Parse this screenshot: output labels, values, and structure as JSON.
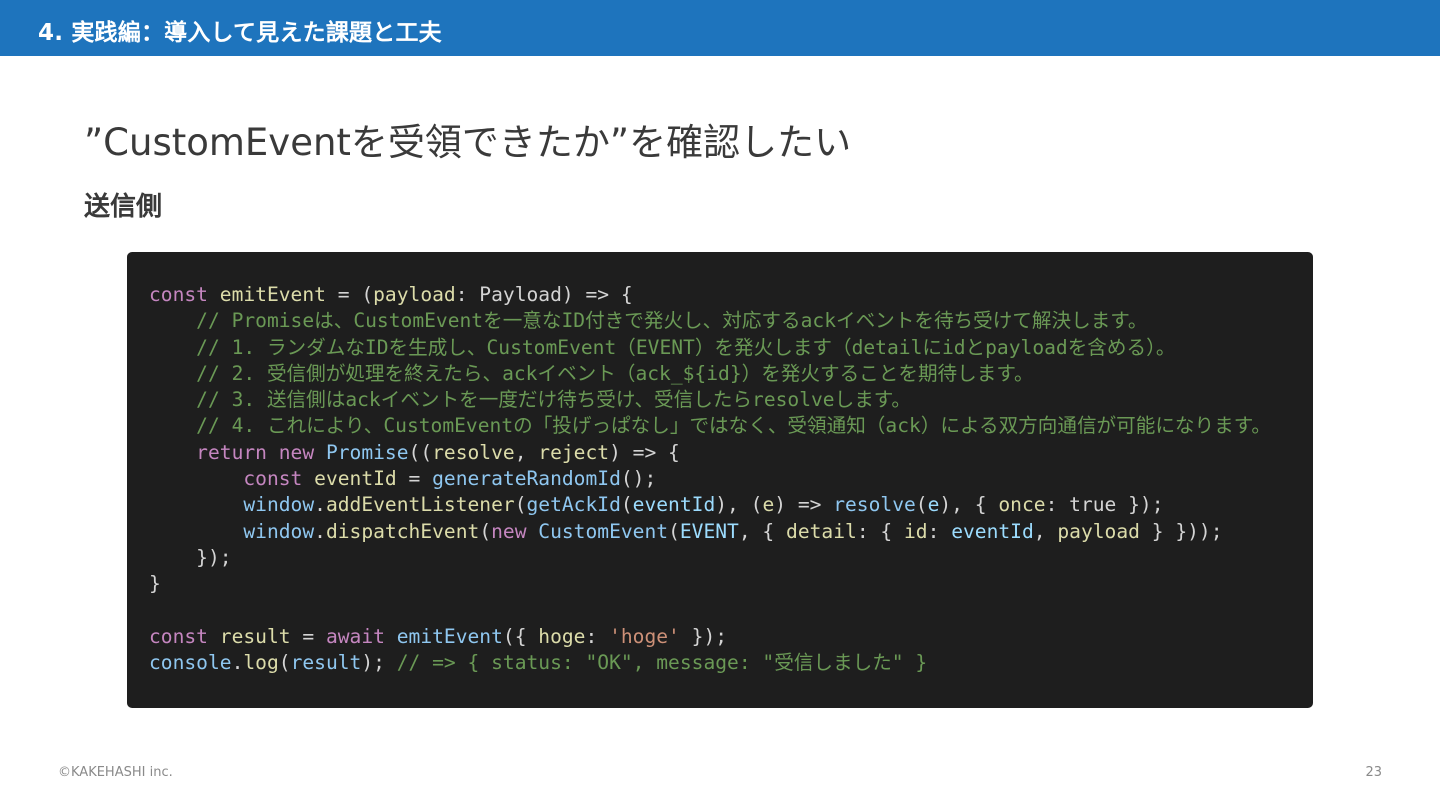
{
  "header": {
    "title": "4. 実践編：導入して見えた課題と工夫"
  },
  "slide": {
    "title": "”CustomEventを受領できたか”を確認したい",
    "section_label": "送信側"
  },
  "code": {
    "lines": [
      [
        {
          "t": "const ",
          "c": "kw"
        },
        {
          "t": "emitEvent",
          "c": "var"
        },
        {
          "t": " = (",
          "c": "pl"
        },
        {
          "t": "payload",
          "c": "var"
        },
        {
          "t": ": Payload) => {",
          "c": "pl"
        }
      ],
      [
        {
          "t": "    // Promiseは、CustomEventを一意なID付きで発火し、対応するackイベントを待ち受けて解決します。",
          "c": "cm"
        }
      ],
      [
        {
          "t": "    // 1. ランダムなIDを生成し、CustomEvent（EVENT）を発火します（detailにidとpayloadを含める）。",
          "c": "cm"
        }
      ],
      [
        {
          "t": "    // 2. 受信側が処理を終えたら、ackイベント（ack_${id}）を発火することを期待します。",
          "c": "cm"
        }
      ],
      [
        {
          "t": "    // 3. 送信側はackイベントを一度だけ待ち受け、受信したらresolveします。",
          "c": "cm"
        }
      ],
      [
        {
          "t": "    // 4. これにより、CustomEventの「投げっぱなし」ではなく、受領通知（ack）による双方向通信が可能になります。",
          "c": "cm"
        }
      ],
      [
        {
          "t": "    return ",
          "c": "kw"
        },
        {
          "t": "new ",
          "c": "kw"
        },
        {
          "t": "Promise",
          "c": "cls"
        },
        {
          "t": "((",
          "c": "pl"
        },
        {
          "t": "resolve",
          "c": "var"
        },
        {
          "t": ", ",
          "c": "pl"
        },
        {
          "t": "reject",
          "c": "var"
        },
        {
          "t": ") => {",
          "c": "pl"
        }
      ],
      [
        {
          "t": "        const ",
          "c": "kw"
        },
        {
          "t": "eventId",
          "c": "var"
        },
        {
          "t": " = ",
          "c": "pl"
        },
        {
          "t": "generateRandomId",
          "c": "fn"
        },
        {
          "t": "();",
          "c": "pl"
        }
      ],
      [
        {
          "t": "        window",
          "c": "fn"
        },
        {
          "t": ".",
          "c": "pl"
        },
        {
          "t": "addEventListener",
          "c": "var"
        },
        {
          "t": "(",
          "c": "pl"
        },
        {
          "t": "getAckId",
          "c": "fn"
        },
        {
          "t": "(",
          "c": "pl"
        },
        {
          "t": "eventId",
          "c": "const"
        },
        {
          "t": "), (",
          "c": "pl"
        },
        {
          "t": "e",
          "c": "var"
        },
        {
          "t": ") => ",
          "c": "pl"
        },
        {
          "t": "resolve",
          "c": "fn"
        },
        {
          "t": "(",
          "c": "pl"
        },
        {
          "t": "e",
          "c": "const"
        },
        {
          "t": "), { ",
          "c": "pl"
        },
        {
          "t": "once",
          "c": "prop"
        },
        {
          "t": ": true });",
          "c": "pl"
        }
      ],
      [
        {
          "t": "        window",
          "c": "fn"
        },
        {
          "t": ".",
          "c": "pl"
        },
        {
          "t": "dispatchEvent",
          "c": "var"
        },
        {
          "t": "(",
          "c": "pl"
        },
        {
          "t": "new ",
          "c": "kw"
        },
        {
          "t": "CustomEvent",
          "c": "cls"
        },
        {
          "t": "(",
          "c": "pl"
        },
        {
          "t": "EVENT",
          "c": "const"
        },
        {
          "t": ", { ",
          "c": "pl"
        },
        {
          "t": "detail",
          "c": "prop"
        },
        {
          "t": ": { ",
          "c": "pl"
        },
        {
          "t": "id",
          "c": "prop"
        },
        {
          "t": ": ",
          "c": "pl"
        },
        {
          "t": "eventId",
          "c": "const"
        },
        {
          "t": ", ",
          "c": "pl"
        },
        {
          "t": "payload",
          "c": "prop"
        },
        {
          "t": " } }));",
          "c": "pl"
        }
      ],
      [
        {
          "t": "    });",
          "c": "pl"
        }
      ],
      [
        {
          "t": "}",
          "c": "pl"
        }
      ],
      [
        {
          "t": "",
          "c": "pl"
        }
      ],
      [
        {
          "t": "const ",
          "c": "kw"
        },
        {
          "t": "result",
          "c": "var"
        },
        {
          "t": " = ",
          "c": "pl"
        },
        {
          "t": "await ",
          "c": "kw"
        },
        {
          "t": "emitEvent",
          "c": "fn"
        },
        {
          "t": "({ ",
          "c": "pl"
        },
        {
          "t": "hoge",
          "c": "prop"
        },
        {
          "t": ": ",
          "c": "pl"
        },
        {
          "t": "'hoge'",
          "c": "str"
        },
        {
          "t": " });",
          "c": "pl"
        }
      ],
      [
        {
          "t": "console",
          "c": "fn"
        },
        {
          "t": ".",
          "c": "pl"
        },
        {
          "t": "log",
          "c": "var"
        },
        {
          "t": "(",
          "c": "pl"
        },
        {
          "t": "result",
          "c": "fn"
        },
        {
          "t": "); ",
          "c": "pl"
        },
        {
          "t": "// => { status: \"OK\", message: \"受信しました\" }",
          "c": "cm"
        }
      ]
    ]
  },
  "footer": {
    "copyright": "©KAKEHASHI inc.",
    "page_number": "23"
  },
  "colors": {
    "header_bg": "#1e74bd",
    "code_bg": "#1e1e1e",
    "keyword": "#c586c0",
    "variable": "#dcdcaa",
    "function": "#8fc7f0",
    "comment": "#6a9955",
    "string": "#ce9178"
  }
}
